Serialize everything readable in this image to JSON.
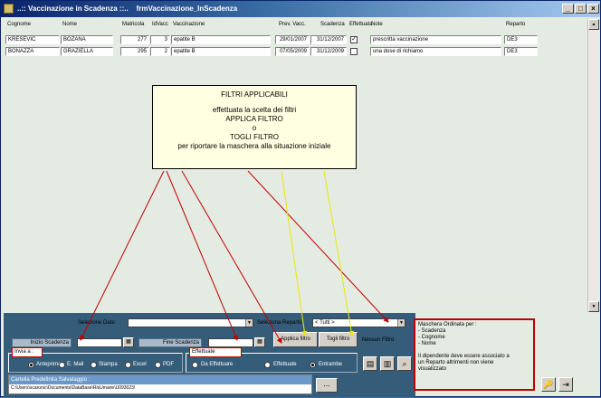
{
  "window": {
    "title": "..:: Vaccinazione in Scadenza ::..    frmVaccinazione_InScadenza"
  },
  "columns": [
    "Cognome",
    "Nome",
    "Matricola",
    "IdVacc",
    "Vaccinazione",
    "Prev. Vacc.",
    "Scadenza",
    "Effettuata",
    "Note",
    "Reparto"
  ],
  "rows": [
    {
      "cognome": "KRESEVIC",
      "nome": "BOZANA",
      "matricola": "277",
      "idvacc": "3",
      "vaccinazione": "epatite B",
      "prev": "29/01/2007",
      "scadenza": "31/12/2007",
      "effettuata": true,
      "note": "prescritta vaccinazione",
      "reparto": "DE3"
    },
    {
      "cognome": "BONAZZA",
      "nome": "GRAZIELLA",
      "matricola": "295",
      "idvacc": "2",
      "vaccinazione": "epatite B",
      "prev": "07/05/2009",
      "scadenza": "31/12/2009",
      "effettuata": false,
      "note": "una dose di richiamo",
      "reparto": "DE3"
    }
  ],
  "note": {
    "title": "FILTRI APPLICABILI",
    "line1": "effettuata la scelta  dei filtri",
    "line2": "APPLICA FILTRO",
    "line3": "o",
    "line4": "TOGLI FILTRO",
    "line5": "per riportare la maschera alla situazione iniziale"
  },
  "filters": {
    "selezione_date_label": "Selezione Date:",
    "inizio_label": "Inizio Scadenza",
    "fine_label": "Fine Scadenza",
    "seleziona_reparto_label": "Seleziona Reparto",
    "reparto_value": "<  Tutti  >",
    "applica_label": "Applica filtro",
    "togli_label": "Togli filtro",
    "nessun_filtro": "Nessun Filtro"
  },
  "invia": {
    "label": "Invia a :",
    "options": [
      "Anteprima",
      "E. Mail",
      "Stampa",
      "Excel",
      "PDF"
    ],
    "selected": "Anteprima"
  },
  "effettuate": {
    "label": "Effettuate",
    "options": [
      "Da Effettuare",
      "Effettuate",
      "Entrambe"
    ],
    "selected": "Entrambe"
  },
  "cartella": {
    "label": "Cartella Predefinita Salvataggio :",
    "path": "C:\\Users\\scaronic\\Documents\\DataBase\\RisUmane\\U093023\\",
    "browse_label": "..."
  },
  "sidebox": {
    "title": "Maschera Ordinata per :",
    "items": [
      "- Scadenza",
      "- Cognome",
      "- Nome"
    ],
    "warning1": "Il dipendente deve essere associato a",
    "warning2": "un Reparto altrimenti non viene",
    "warning3": "visualizzato"
  },
  "icons": [
    "window-icon",
    "report-icon",
    "chart-icon",
    "preview-icon",
    "help-icon",
    "exit-icon"
  ]
}
